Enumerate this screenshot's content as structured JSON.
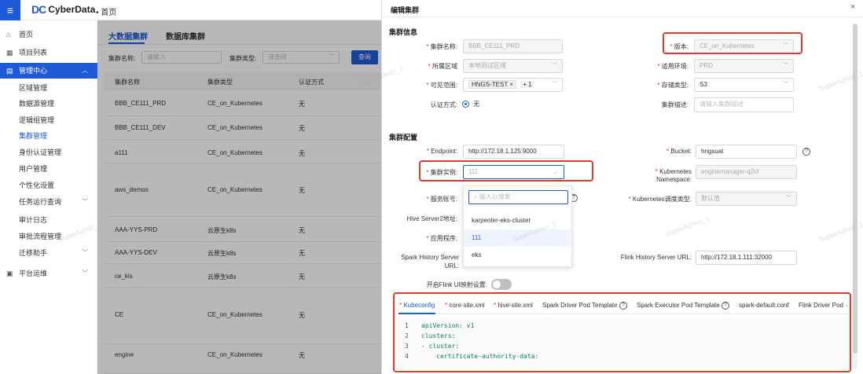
{
  "app": {
    "logo_mark": "DC",
    "name": "CyberData",
    "breadcrumb": "• 首页"
  },
  "sidebar": {
    "items": [
      {
        "icon": "home-icon",
        "glyph": "⌂",
        "label": "首页"
      },
      {
        "icon": "grid-icon",
        "glyph": "▦",
        "label": "项目列表"
      },
      {
        "icon": "manage-icon",
        "glyph": "▤",
        "label": "管理中心",
        "chevron": "︿"
      },
      {
        "label": "区域管理"
      },
      {
        "label": "数据源管理"
      },
      {
        "label": "逻辑组管理"
      },
      {
        "label": "集群管理"
      },
      {
        "label": "身份认证管理"
      },
      {
        "label": "用户管理"
      },
      {
        "label": "个性化设置"
      },
      {
        "label": "任务运行查询",
        "chevron": "﹀"
      },
      {
        "label": "审计日志"
      },
      {
        "label": "审批流程管理"
      },
      {
        "label": "迁移助手",
        "chevron": "﹀"
      },
      {
        "icon": "ops-icon",
        "glyph": "▣",
        "label": "平台运维",
        "chevron": "﹀"
      }
    ]
  },
  "main": {
    "tabs": [
      "大数据集群",
      "数据库集群"
    ],
    "filters": {
      "name_label": "集群名称:",
      "name_placeholder": "请输入",
      "type_label": "集群类型:",
      "type_placeholder": "请选择",
      "search_button": "查询"
    },
    "columns": [
      "集群名称",
      "集群类型",
      "认证方式"
    ],
    "rows": [
      [
        "BBB_CE111_PRD",
        "CE_on_Kubernetes",
        "无"
      ],
      [
        "BBB_CE111_DEV",
        "CE_on_Kubernetes",
        "无"
      ],
      [
        "a111",
        "CE_on_Kubernetes",
        "无"
      ],
      [
        "aws_demos",
        "CE_on_Kubernetes",
        "无"
      ],
      [
        "AAA-YYS-PRD",
        "云原生k8s",
        "无"
      ],
      [
        "AAA-YYS-DEV",
        "云原生k8s",
        "无"
      ],
      [
        "ce_kis",
        "云原生k8s",
        "无"
      ],
      [
        "CE",
        "CE_on_Kubernetes",
        "无"
      ],
      [
        "engine",
        "CE_on_Kubernetes",
        "无"
      ]
    ]
  },
  "drawer": {
    "title": "编辑集群",
    "close": "×",
    "section_info": "集群信息",
    "section_config": "集群配置",
    "cluster_name_label": "集群名称:",
    "cluster_name_value": "BBB_CE111_PRD",
    "version_label": "版本:",
    "version_value": "CE_on_Kubernetes",
    "region_label": "所属区域",
    "region_value": "本地测试区域",
    "env_label": "适用环境:",
    "env_value": "PRD",
    "visible_label": "可见范围:",
    "visible_tag": "HNGS-TEST",
    "visible_more": "+ 1",
    "storage_label": "存储类型:",
    "storage_value": "S3",
    "auth_label": "认证方式:",
    "auth_value": "无",
    "desc_label": "集群描述:",
    "desc_placeholder": "请输入集群描述",
    "endpoint_label": "Endpoint:",
    "endpoint_value": "http://172.18.1.125:9000",
    "bucket_label": "Bucket:",
    "bucket_value": "hngsuat",
    "instance_label": "集群实例:",
    "instance_value": "111",
    "k8s_ns_label": "Kubernetes Namespace:",
    "k8s_ns_value": "enginemanager-q2sf",
    "service_label": "服务账号:",
    "k8s_sched_label": "Kubernetes调度类型:",
    "k8s_sched_value": "默认值",
    "hive_label": "Hive Server2地址:",
    "app_label": "应用程序:",
    "spark_hist_label": "Spark History Server URL:",
    "flink_hist_label": "Flink History Server URL:",
    "flink_hist_value": "http://172.18.1.111:32000",
    "flink_ui_label": "开启Flink UI映射设置:",
    "dropdown": {
      "search_placeholder": "输入以搜索",
      "options": [
        "karpenter-eks-cluster",
        "111",
        "eks"
      ]
    },
    "editor_tabs": [
      "Kubeconfig",
      "core-site.xml",
      "hive-site.xml",
      "Spark Driver Pod Template",
      "Spark Executor Pod Template",
      "spark-default.conf",
      "Flink Driver Pod"
    ],
    "editor_lines": [
      {
        "n": "1",
        "text": "apiVersion: v1"
      },
      {
        "n": "2",
        "text": "clusters:"
      },
      {
        "n": "3",
        "text": "- cluster:"
      },
      {
        "n": "4",
        "text": "    certificate-authority-data:"
      }
    ]
  },
  "watermark": "SuperAdmin_1",
  "colors": {
    "accent": "#1e5ad6",
    "highlight": "#e23b2e"
  }
}
